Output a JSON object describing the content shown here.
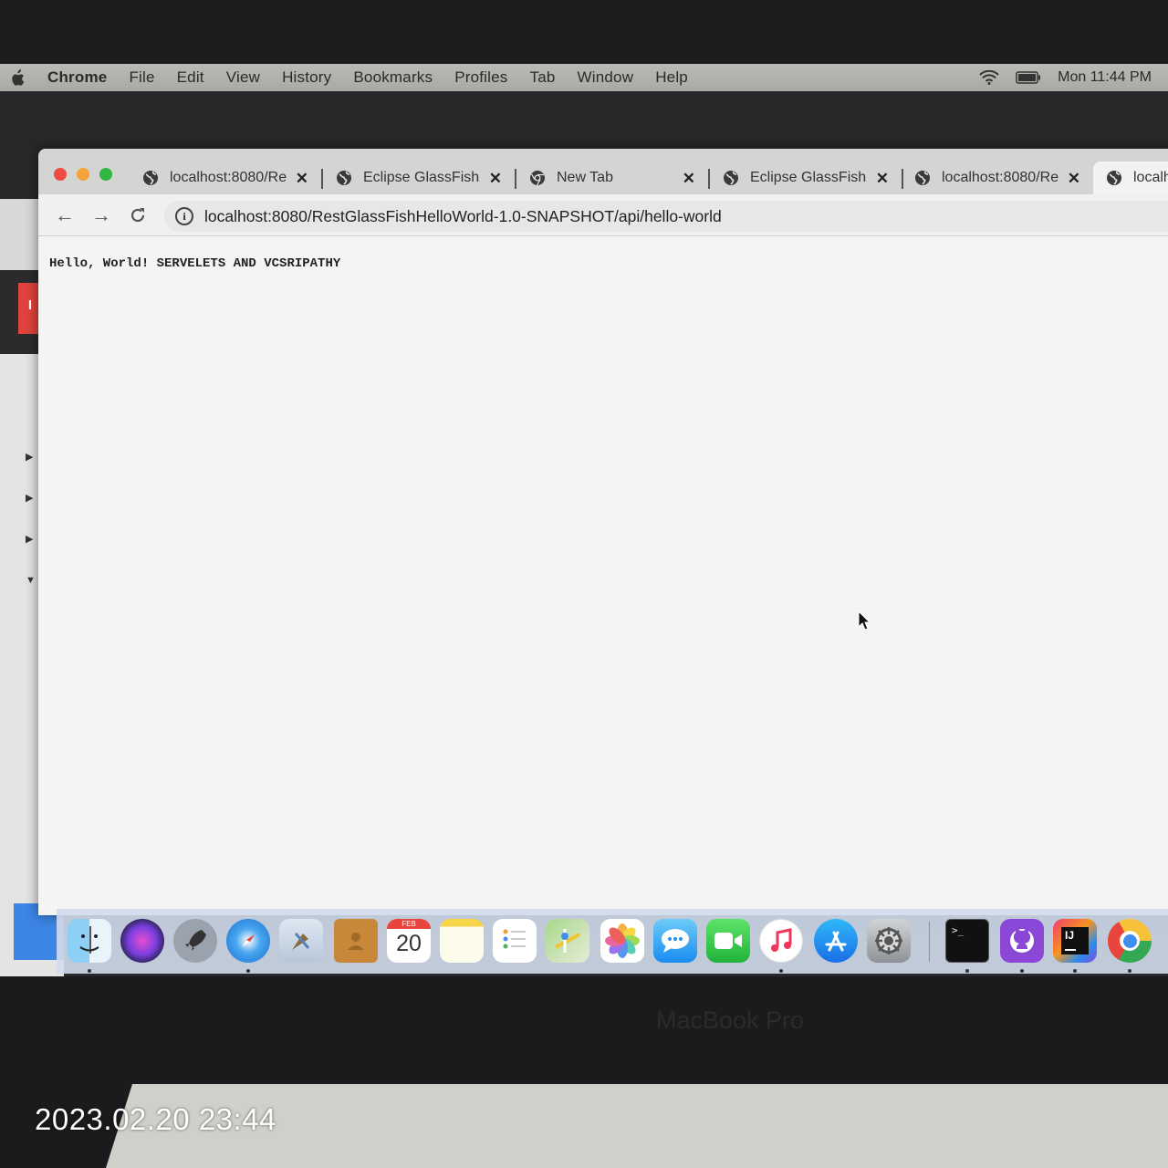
{
  "menubar": {
    "items": [
      "Chrome",
      "File",
      "Edit",
      "View",
      "History",
      "Bookmarks",
      "Profiles",
      "Tab",
      "Window",
      "Help"
    ],
    "clock": "Mon 11:44 PM"
  },
  "browser": {
    "tabs": [
      {
        "title": "localhost:8080/Re",
        "icon": "globe-icon",
        "active": false
      },
      {
        "title": "Eclipse GlassFish",
        "icon": "globe-icon",
        "active": false
      },
      {
        "title": "New Tab",
        "icon": "chrome-icon",
        "active": false
      },
      {
        "title": "Eclipse GlassFish",
        "icon": "globe-icon",
        "active": false
      },
      {
        "title": "localhost:8080/Re",
        "icon": "globe-icon",
        "active": false
      },
      {
        "title": "localh",
        "icon": "globe-icon",
        "active": true
      }
    ],
    "url": "localhost:8080/RestGlassFishHelloWorld-1.0-SNAPSHOT/api/hello-world",
    "page_text": "Hello, World! SERVELETS AND VCSRIPATHY"
  },
  "dock": {
    "apps": [
      "finder-icon",
      "siri-icon",
      "launchpad-icon",
      "safari-icon",
      "mail-icon",
      "contacts-icon",
      "calendar-icon",
      "notes-icon",
      "reminders-icon",
      "maps-icon",
      "photos-icon",
      "messages-icon",
      "facetime-icon",
      "music-icon",
      "app-store-icon",
      "system-preferences-icon",
      "terminal-icon",
      "github-desktop-icon",
      "intellij-icon",
      "chrome-icon"
    ],
    "calendar_month": "FEB",
    "calendar_day": "20"
  },
  "device_label": "MacBook Pro",
  "photo_timestamp": "2023.02.20 23:44"
}
